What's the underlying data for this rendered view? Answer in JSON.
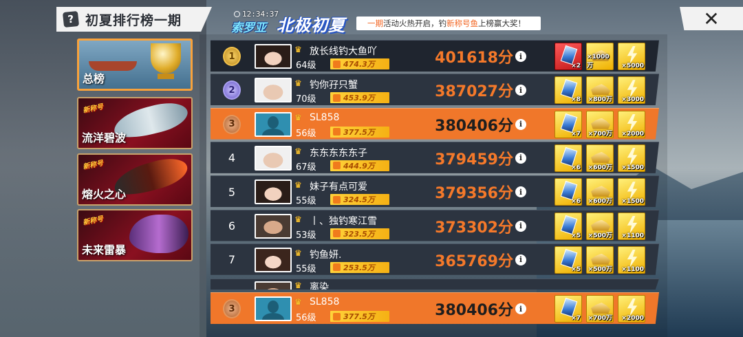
{
  "header": {
    "title": "初夏排行榜一期",
    "help_icon": "?",
    "close_icon": "✕"
  },
  "event": {
    "time": "12:34:37",
    "logo_a": "索罗亚",
    "logo_b": "北极初夏",
    "msg_a": "一期",
    "msg_b": "活动火热开启，钓",
    "msg_c": "新称号鱼",
    "msg_d": "上榜赢大奖！"
  },
  "categories": [
    {
      "label": "总榜",
      "active": true
    },
    {
      "label": "流洋碧波",
      "tag": "新称号",
      "active": false
    },
    {
      "label": "熔火之心",
      "tag": "新称号",
      "active": false
    },
    {
      "label": "未来雷暴",
      "tag": "新称号",
      "active": false
    }
  ],
  "rows": [
    {
      "rank": "1",
      "medal": "gold",
      "name": "放长线钓大鱼吖",
      "level": "64级",
      "power": "474.3万",
      "score": "401618分",
      "avatar": "face-a",
      "rewards": [
        {
          "type": "card",
          "qty": "×2",
          "red": true
        },
        {
          "type": "gold",
          "qty": "×1000万"
        },
        {
          "type": "bolt",
          "qty": "×5000"
        }
      ]
    },
    {
      "rank": "2",
      "medal": "silver",
      "name": "钓你孖只蟹",
      "level": "70级",
      "power": "453.9万",
      "score": "387027分",
      "avatar": "face-b",
      "rewards": [
        {
          "type": "card",
          "qty": "×8"
        },
        {
          "type": "gold",
          "qty": "×800万"
        },
        {
          "type": "bolt",
          "qty": "×3000"
        }
      ]
    },
    {
      "rank": "3",
      "medal": "bronze",
      "name": "SL858",
      "level": "56级",
      "power": "377.5万",
      "score": "380406分",
      "avatar": "silhouette",
      "me": true,
      "rewards": [
        {
          "type": "card",
          "qty": "×7"
        },
        {
          "type": "gold",
          "qty": "×700万"
        },
        {
          "type": "bolt",
          "qty": "×2000"
        }
      ]
    },
    {
      "rank": "4",
      "name": "东东东东东子",
      "level": "67级",
      "power": "444.9万",
      "score": "379459分",
      "avatar": "face-b",
      "rewards": [
        {
          "type": "card",
          "qty": "×6"
        },
        {
          "type": "gold",
          "qty": "×600万"
        },
        {
          "type": "bolt",
          "qty": "×1500"
        }
      ]
    },
    {
      "rank": "5",
      "name": "妹子有点可爱",
      "level": "55级",
      "power": "324.5万",
      "score": "379356分",
      "avatar": "face-a",
      "rewards": [
        {
          "type": "card",
          "qty": "×6"
        },
        {
          "type": "gold",
          "qty": "×600万"
        },
        {
          "type": "bolt",
          "qty": "×1500"
        }
      ]
    },
    {
      "rank": "6",
      "name": "丨、独钓寒江雪",
      "level": "53级",
      "power": "323.5万",
      "score": "373302分",
      "avatar": "face-c",
      "rewards": [
        {
          "type": "card",
          "qty": "×5"
        },
        {
          "type": "gold",
          "qty": "×500万"
        },
        {
          "type": "bolt",
          "qty": "×1100"
        }
      ]
    },
    {
      "rank": "7",
      "name": "钓鱼妍.",
      "level": "55级",
      "power": "253.5万",
      "score": "365769分",
      "avatar": "face-d",
      "rewards": [
        {
          "type": "card",
          "qty": "×5"
        },
        {
          "type": "gold",
          "qty": "×500万"
        },
        {
          "type": "bolt",
          "qty": "×1100"
        }
      ]
    }
  ],
  "partial_row": {
    "name": "离染"
  },
  "my_row": {
    "rank": "3",
    "medal": "bronze",
    "name": "SL858",
    "level": "56级",
    "power": "377.5万",
    "score": "380406分",
    "avatar": "silhouette",
    "rewards": [
      {
        "type": "card",
        "qty": "×7"
      },
      {
        "type": "gold",
        "qty": "×700万"
      },
      {
        "type": "bolt",
        "qty": "×2000"
      }
    ]
  },
  "info_icon": "i",
  "colors": {
    "accent_orange": "#f0772a",
    "score_orange": "#f5792a",
    "gold": "#f5b114"
  }
}
